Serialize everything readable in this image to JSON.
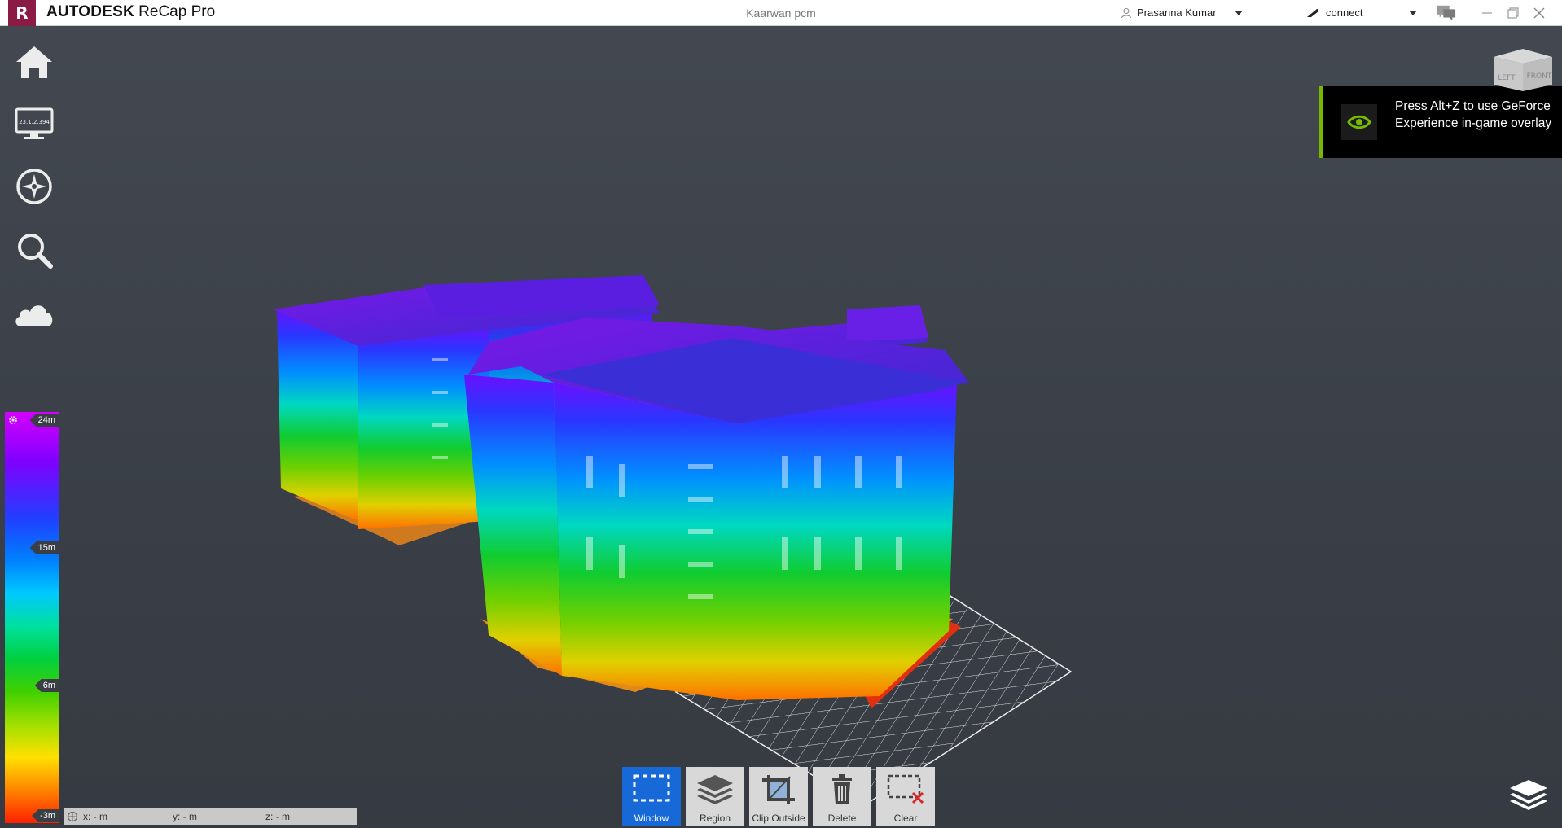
{
  "app": {
    "logo_letter": "R",
    "brand": "AUTODESK",
    "product": "ReCap Pro",
    "document_title": "Kaarwan pcm",
    "user_name": "Prasanna Kumar",
    "connect_label": "connect"
  },
  "left_rail": {
    "items": [
      {
        "name": "home",
        "icon": "home-icon"
      },
      {
        "name": "display-settings",
        "icon": "monitor-icon",
        "monitor_text": "23.1.2.394"
      },
      {
        "name": "navigation",
        "icon": "compass-icon"
      },
      {
        "name": "search",
        "icon": "search-icon"
      },
      {
        "name": "cloud",
        "icon": "cloud-icon"
      }
    ]
  },
  "color_scale": {
    "max_label": "24m",
    "mid_high_label": "15m",
    "mid_low_label": "6m",
    "min_label": "-3m"
  },
  "coords": {
    "x": "x:  - m",
    "y": "y:  - m",
    "z": "z:  - m"
  },
  "toolbar": {
    "items": [
      {
        "label": "Window",
        "active": true
      },
      {
        "label": "Region",
        "active": false
      },
      {
        "label": "Clip Outside",
        "active": false
      },
      {
        "label": "Delete",
        "active": false
      },
      {
        "label": "Clear",
        "active": false
      }
    ]
  },
  "overlay": {
    "message": "Press Alt+Z to use GeForce Experience in-game overlay"
  },
  "viewcube": {
    "left_label": "LEFT",
    "front_label": "FRONT"
  },
  "colors": {
    "brand": "#8a1b45",
    "active_tool": "#1669d6",
    "nvidia_green": "#76b900"
  }
}
